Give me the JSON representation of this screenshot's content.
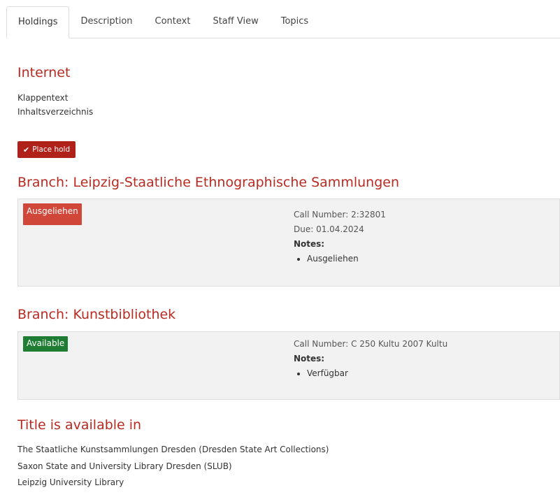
{
  "tabs": [
    {
      "label": "Holdings",
      "active": true
    },
    {
      "label": "Description",
      "active": false
    },
    {
      "label": "Context",
      "active": false
    },
    {
      "label": "Staff View",
      "active": false
    },
    {
      "label": "Topics",
      "active": false
    }
  ],
  "internet": {
    "heading": "Internet",
    "links": [
      "Klappentext",
      "Inhaltsverzeichnis"
    ]
  },
  "hold_button": {
    "label": "Place hold",
    "icon": "check-icon"
  },
  "branches": [
    {
      "heading": "Branch: Leipzig-Staatliche Ethnographische Sammlungen",
      "status": "Ausgeliehen",
      "status_color": "#d0473a",
      "call_number": "Call Number: 2:32801",
      "due": "Due: 01.04.2024",
      "notes_label": "Notes:",
      "notes": [
        "Ausgeliehen"
      ]
    },
    {
      "heading": "Branch: Kunstbibliothek",
      "status": "Available",
      "status_color": "#1e7d32",
      "call_number": "Call Number: C 250 Kultu 2007 Kultu",
      "notes_label": "Notes:",
      "notes": [
        "Verfügbar"
      ]
    }
  ],
  "available_in": {
    "heading": "Title is available in",
    "libraries": [
      "The Staatliche Kunstsammlungen Dresden (Dresden State Art Collections)",
      "Saxon State and University Library Dresden (SLUB)",
      "Leipzig University Library"
    ]
  },
  "colors": {
    "heading": "#b92a20",
    "hold_button": "#b0211a"
  }
}
